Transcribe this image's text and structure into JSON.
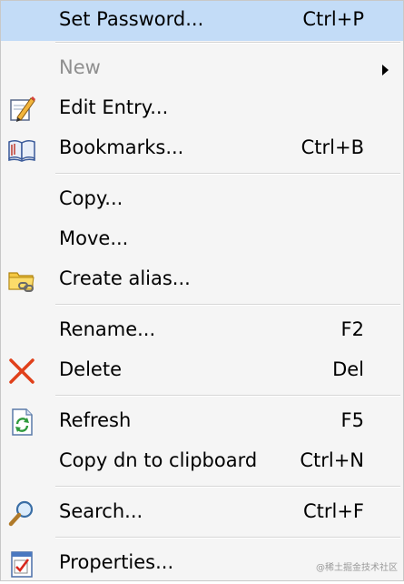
{
  "menu": {
    "items": [
      {
        "label": "Set Password...",
        "shortcut": "Ctrl+P"
      },
      {
        "label": "New"
      },
      {
        "label": "Edit Entry...",
        "icon": "pencil-icon"
      },
      {
        "label": "Bookmarks...",
        "shortcut": "Ctrl+B",
        "icon": "book-icon"
      },
      {
        "label": "Copy..."
      },
      {
        "label": "Move..."
      },
      {
        "label": "Create alias...",
        "icon": "folder-link-icon"
      },
      {
        "label": "Rename...",
        "shortcut": "F2"
      },
      {
        "label": "Delete",
        "shortcut": "Del",
        "icon": "delete-x-icon"
      },
      {
        "label": "Refresh",
        "shortcut": "F5",
        "icon": "refresh-icon"
      },
      {
        "label": "Copy dn to clipboard",
        "shortcut": "Ctrl+N"
      },
      {
        "label": "Search...",
        "shortcut": "Ctrl+F",
        "icon": "magnifier-icon"
      },
      {
        "label": "Properties...",
        "icon": "properties-check-icon"
      }
    ]
  },
  "watermark": "@稀土掘金技术社区",
  "colors": {
    "highlight": "#c3dcf7",
    "disabled_text": "#8f8f8f",
    "delete_red": "#e0401a"
  }
}
